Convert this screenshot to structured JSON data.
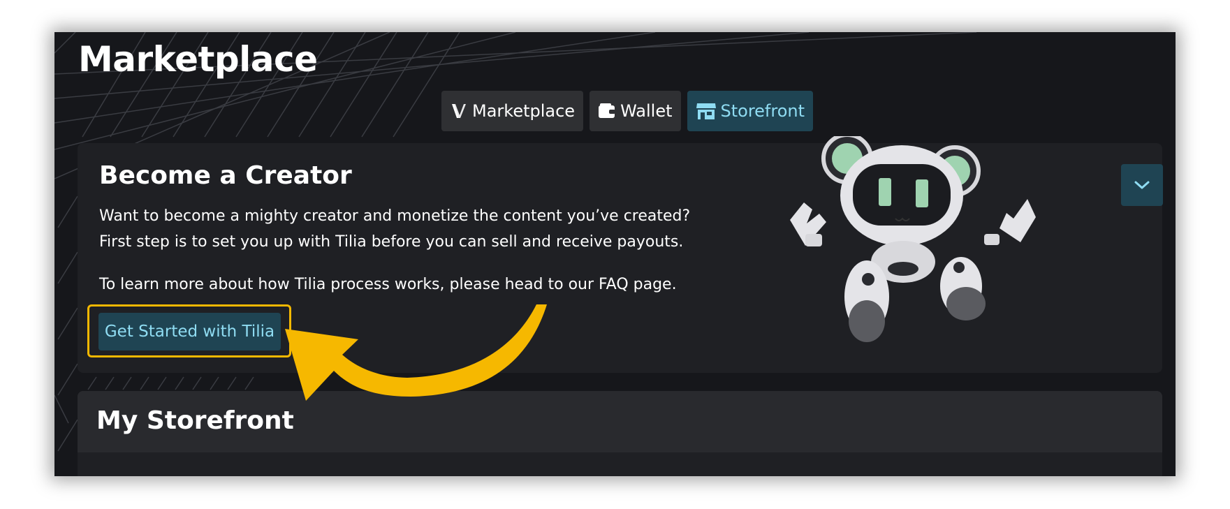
{
  "header": {
    "title": "Marketplace"
  },
  "tabs": [
    {
      "label": "Marketplace",
      "icon": "v-logo-icon",
      "active": false
    },
    {
      "label": "Wallet",
      "icon": "wallet-icon",
      "active": false
    },
    {
      "label": "Storefront",
      "icon": "storefront-icon",
      "active": true
    }
  ],
  "creator": {
    "title": "Become a Creator",
    "line1": "Want to become a mighty creator and monetize the content you’ve created?",
    "line2": "First step is to set you up with Tilia before you can sell and receive payouts.",
    "line3": "To learn more about how Tilia process works, please head to our FAQ page.",
    "cta_label": "Get Started with Tilia",
    "collapse_icon": "chevron-down-icon"
  },
  "storefront": {
    "title": "My Storefront"
  },
  "colors": {
    "background": "#16171b",
    "card": "#1f2024",
    "accent_bg": "#1f4453",
    "accent_text": "#8fdcf2",
    "highlight": "#f6b800"
  }
}
